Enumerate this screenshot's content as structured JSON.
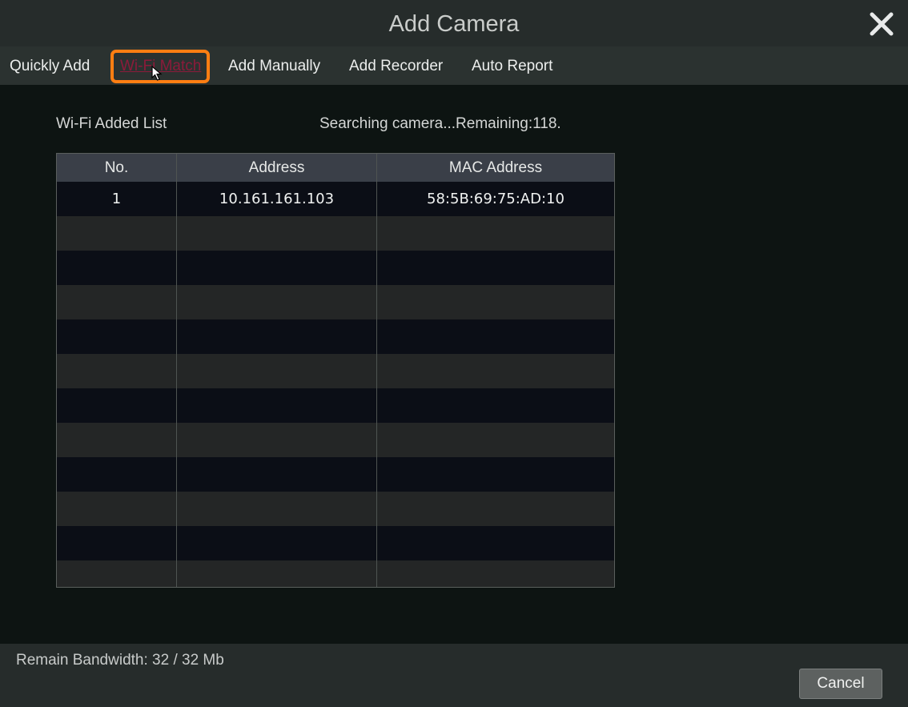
{
  "window": {
    "title": "Add Camera"
  },
  "tabs": [
    {
      "label": "Quickly Add",
      "active": false
    },
    {
      "label": "Wi-Fi Match",
      "active": true
    },
    {
      "label": "Add Manually",
      "active": false
    },
    {
      "label": "Add Recorder",
      "active": false
    },
    {
      "label": "Auto Report",
      "active": false
    }
  ],
  "main": {
    "list_title": "Wi-Fi Added List",
    "status": "Searching camera...Remaining:118."
  },
  "table": {
    "columns": [
      "No.",
      "Address",
      "MAC Address"
    ],
    "rows": [
      {
        "no": "1",
        "address": "10.161.161.103",
        "mac": "58:5B:69:75:AD:10"
      }
    ]
  },
  "footer": {
    "bandwidth": "Remain Bandwidth: 32 / 32 Mb",
    "cancel_label": "Cancel"
  },
  "icons": {
    "close": "close-icon",
    "cursor": "mouse-pointer-icon"
  },
  "colors": {
    "highlight": "#ff7e12",
    "active_tab_text": "#8b1b3a"
  }
}
